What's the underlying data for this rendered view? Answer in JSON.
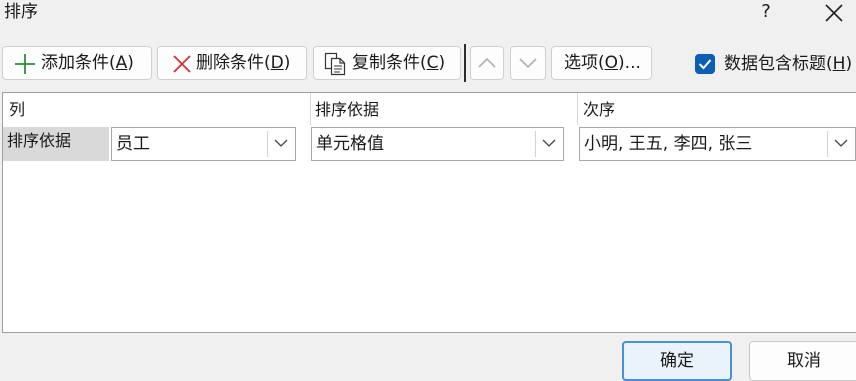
{
  "window": {
    "title": "排序",
    "help_glyph": "?"
  },
  "toolbar": {
    "add_label": "添加条件(",
    "add_key": "A",
    "delete_label": "删除条件(",
    "delete_key": "D",
    "copy_label": "复制条件(",
    "copy_key": "C",
    "options_label": "选项(",
    "options_key": "O",
    "options_suffix": ")...",
    "close_paren": ")",
    "has_headers_label": "数据包含标题(",
    "has_headers_key": "H",
    "has_headers_checked": true
  },
  "grid": {
    "headers": {
      "column": "列",
      "sort_on": "排序依据",
      "order": "次序"
    },
    "rows": [
      {
        "label": "排序依据",
        "column": "员工",
        "sort_on": "单元格值",
        "order": "小明, 王五, 李四, 张三"
      }
    ]
  },
  "footer": {
    "ok_label": "确定",
    "cancel_label": "取消"
  },
  "colors": {
    "accent": "#0a5fb4",
    "add_icon": "#2e8b3a",
    "delete_icon": "#d13438",
    "ok_border": "#4a90d9"
  },
  "icons": {
    "add": "plus-icon",
    "delete": "x-icon",
    "copy": "copy-document-icon",
    "up": "chevron-up-icon",
    "down": "chevron-down-icon",
    "check": "checkmark-icon",
    "close": "close-icon"
  }
}
